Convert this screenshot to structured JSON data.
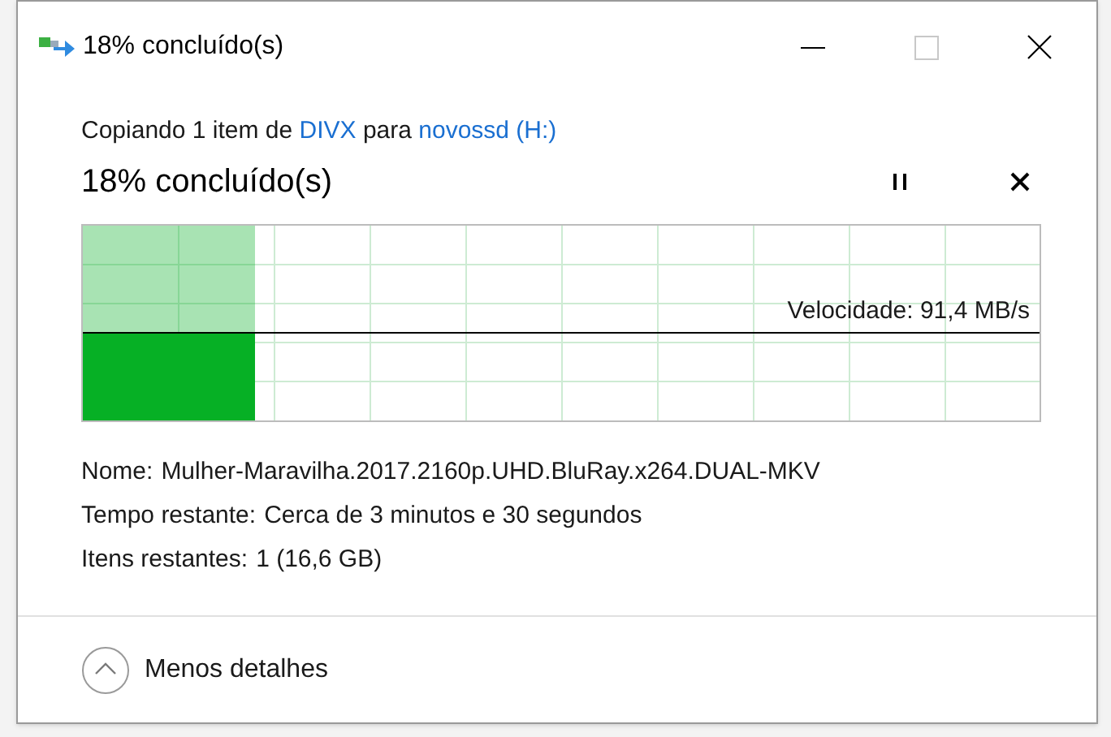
{
  "window": {
    "title": "18% concluído(s)"
  },
  "copy_line": {
    "prefix": "Copiando 1 item de",
    "source": "DIVX",
    "middle": "para",
    "destination": "novossd (H:)"
  },
  "heading": "18% concluído(s)",
  "progress": {
    "level": 0.18
  },
  "speed": {
    "level": 0.45,
    "label": "Velocidade: 91,4 MB/s"
  },
  "details": [
    {
      "label": "Nome:",
      "value": "Mulher-Maravilha.2017.2160p.UHD.BluRay.x264.DUAL-MKV"
    },
    {
      "label": "Tempo restante:",
      "value": "Cerca de 3 minutos e 30 segundos"
    },
    {
      "label": "Itens restantes:",
      "value": "1 (16,6 GB)"
    }
  ],
  "footer": {
    "label": "Menos detalhes",
    "expanded": true
  }
}
